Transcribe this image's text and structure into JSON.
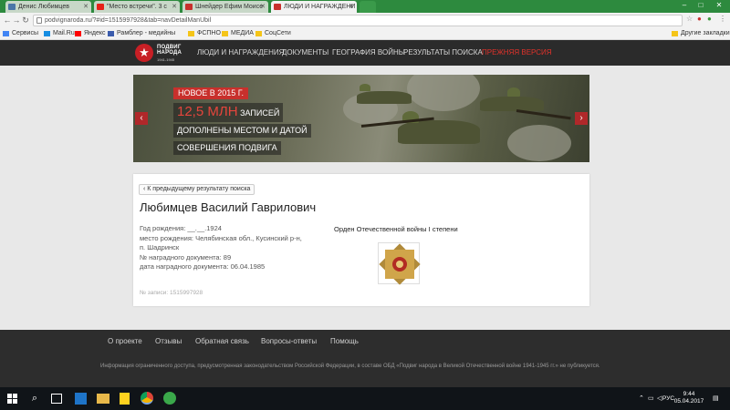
{
  "browser": {
    "tabs": [
      {
        "title": "Денис Любимцев",
        "color": "#4a76a8"
      },
      {
        "title": "\"Место встречи\". 3 с",
        "color": "#e62117"
      },
      {
        "title": "Шнейдер Ефим Моисе",
        "color": "#c8302c"
      },
      {
        "title": "ЛЮДИ И НАГРАЖДЕНИ",
        "color": "#c8302c"
      }
    ],
    "url": "podvignaroda.ru/?#id=1515997928&tab=navDetailManUbil",
    "bookmarks": [
      {
        "label": "Сервисы",
        "color": "#4285f4"
      },
      {
        "label": "Mail.Ru",
        "color": "#168de2"
      },
      {
        "label": "Яндекс",
        "color": "#ff0000"
      },
      {
        "label": "Рамблер - медийны",
        "color": "#3b5cad"
      },
      {
        "label": "ФСПНО",
        "color": "#f5c518"
      },
      {
        "label": "МЕДИА",
        "color": "#f5c518"
      },
      {
        "label": "СоцСети",
        "color": "#f5c518"
      }
    ],
    "other_bookmarks": "Другие закладки"
  },
  "site": {
    "logo_line1": "ПОДВИГ",
    "logo_line2": "НАРОДА",
    "logo_years": "1941-1945",
    "nav": [
      "ЛЮДИ И НАГРАЖДЕНИЯ",
      "ДОКУМЕНТЫ",
      "ГЕОГРАФИЯ ВОЙНЫ",
      "РЕЗУЛЬТАТЫ ПОИСКА"
    ],
    "nav_old": "ПРЕЖНЯЯ ВЕРСИЯ",
    "banner": {
      "badge": "НОВОЕ В 2015 Г.",
      "big": "12,5 МЛН",
      "line1_rest": "ЗАПИСЕЙ",
      "line2": "ДОПОЛНЕНЫ МЕСТОМ И ДАТОЙ",
      "line3": "СОВЕРШЕНИЯ ПОДВИГА"
    }
  },
  "record": {
    "back_label": "К предыдущему результату поиска",
    "name": "Любимцев Василий Гаврилович",
    "birth_year": "Год рождения: __.__.1924",
    "birth_place_1": "место рождения: Челябинская обл., Кусинский р-н,",
    "birth_place_2": "п. Шадринск",
    "doc_number": "№ наградного документа: 89",
    "doc_date": "дата наградного документа: 06.04.1985",
    "award": "Орден Отечественной войны I степени",
    "record_number": "№ записи: 1515997928"
  },
  "footer": {
    "links": [
      "О проекте",
      "Отзывы",
      "Обратная связь",
      "Вопросы-ответы",
      "Помощь"
    ],
    "note": "Информация ограниченного доступа, предусмотренная законодательством Российской Федерации, в составе ОБД «Подвиг народа в Великой Отечественной войне 1941-1945 гг.» не публикуется."
  },
  "taskbar": {
    "lang": "РУС",
    "time": "9:44",
    "date": "05.04.2017"
  }
}
